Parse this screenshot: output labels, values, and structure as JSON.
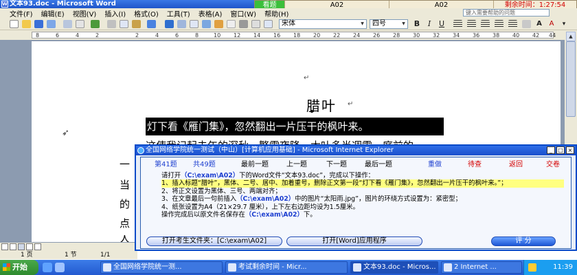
{
  "window": {
    "title": "文本93.doc - Microsoft Word",
    "icon": "word-icon"
  },
  "exam_bar": {
    "status": "看题",
    "file1": "A02",
    "file2": "A02",
    "time_label": "剩余时间：",
    "time": "1:27:54"
  },
  "menu": {
    "items": [
      "文件(F)",
      "编辑(E)",
      "视图(V)",
      "插入(I)",
      "格式(O)",
      "工具(T)",
      "表格(A)",
      "窗口(W)",
      "帮助(H)"
    ],
    "help_placeholder": "键入需要帮助的问题"
  },
  "toolbar": {
    "font_name": "宋体",
    "font_size": "四号",
    "bold": "B",
    "italic": "I",
    "underline": "U"
  },
  "ruler": {
    "ticks": [
      "8",
      "6",
      "4",
      "2",
      "2",
      "4",
      "6",
      "8",
      "10",
      "12",
      "14",
      "16",
      "18",
      "20",
      "22",
      "24",
      "26",
      "28",
      "30",
      "32",
      "34",
      "36",
      "38",
      "40",
      "42",
      "44"
    ]
  },
  "document": {
    "para_mark": "↵",
    "title": "腊叶",
    "highlighted_line": "灯下看《雁门集》，忽然翻出一片压干的枫叶来。",
    "hidden_line": "这使我记起去年的深秋。繁霜夜降，木叶多半凋零，庭前的",
    "left_chars": [
      "一",
      "当",
      "的",
      "点",
      "人"
    ]
  },
  "status_bar": {
    "page": "1 页",
    "section": "1 节",
    "pages": "1/1"
  },
  "dialog": {
    "title": "全国网络学院统一测试（中山）[计算机应用基础] - Microsoft Internet Explorer",
    "nav": {
      "current": "第41题",
      "total": "共49题",
      "first": "最前一题",
      "prev": "上一题",
      "next": "下一题",
      "last": "最后一题",
      "redo": "重做",
      "review": "待查",
      "back": "返回",
      "submit": "交卷"
    },
    "question": {
      "intro_a": "请打开",
      "path1": "（C:\\exam\\A02）",
      "intro_b": "下的Word文件“文本93.doc”，完成以下操作：",
      "step1": "1、插入标题“腊叶”，黑体、二号、居中、加着重号，删除正文第一段“灯下看《雁门集》，忽然翻出一片压干的枫叶来。”；",
      "step2": "2、将正文设置为黑体、三号、两端对齐；",
      "step3a": "3、在文章最后一句前插入",
      "path2": "（C:\\exam\\A02）",
      "step3b": "中的图片“太阳雨.jpg”，图片的环绕方式设置为：紧密型；",
      "step4": "4、纸张设置为A4（21×29.7 厘米），上下左右边距均设为1.5厘米。",
      "save_a": "操作完成后以原文件名保存在",
      "path3": "（C:\\exam\\A02）",
      "save_b": "下。"
    },
    "buttons": {
      "open_folder": "打开考生文件夹：[C:\\exam\\A02]",
      "open_word": "打开[Word]应用程序",
      "score": "评 分"
    }
  },
  "taskbar": {
    "start": "开始",
    "tasks": [
      "全国网络学院统一测...",
      "考试剩余时间 - Micr...",
      "文本93.doc - Micros...",
      "2 Internet ..."
    ],
    "clock": "11:39"
  },
  "colors": {
    "title_blue": "#1f55c9",
    "highlight": "#ffff80",
    "accent_red": "#d40000",
    "path_blue": "#1d3fd0"
  }
}
